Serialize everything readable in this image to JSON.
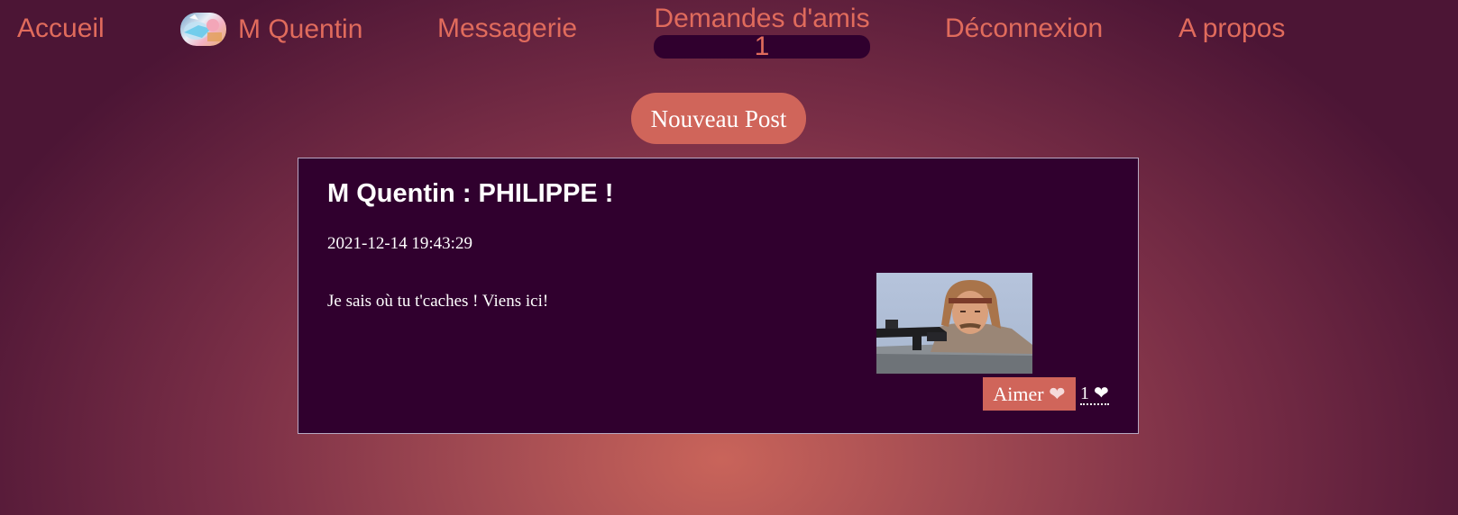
{
  "nav": {
    "home": "Accueil",
    "profile": "M Quentin",
    "messages": "Messagerie",
    "friend_requests": {
      "label": "Demandes d'amis",
      "count": "1"
    },
    "logout": "Déconnexion",
    "about": "A propos"
  },
  "new_post_label": "Nouveau Post",
  "post": {
    "title": "M Quentin : PHILIPPE !",
    "date": "2021-12-14 19:43:29",
    "body": "Je sais où tu t'caches ! Viens ici!",
    "like_label": "Aimer",
    "like_icon": "heart-icon",
    "like_count": "1"
  },
  "colors": {
    "accent": "#e06b5c",
    "button_bg": "#d0655a",
    "card_bg": "#30002e",
    "text": "#ffffff"
  }
}
